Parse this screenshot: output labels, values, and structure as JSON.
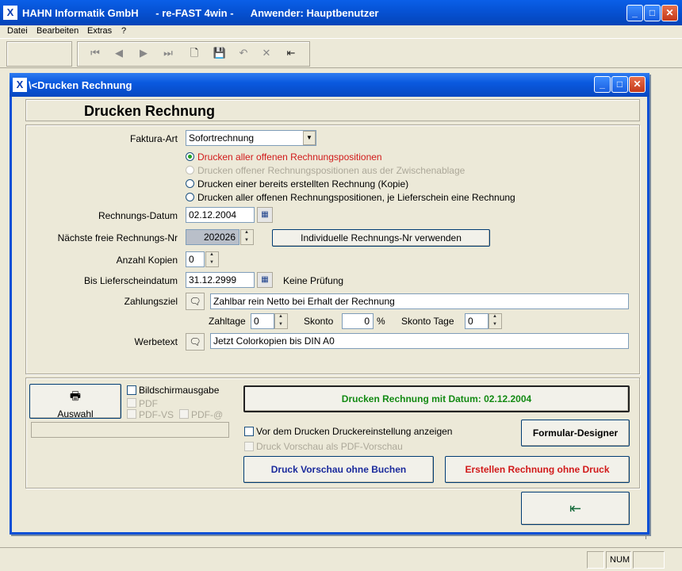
{
  "app": {
    "title": "HAHN Informatik GmbH      - re-FAST 4win -      Anwender: Hauptbenutzer",
    "logo": "X"
  },
  "menu": {
    "datei": "Datei",
    "bearbeiten": "Bearbeiten",
    "extras": "Extras",
    "help": "?"
  },
  "dialog": {
    "title": "\\<Drucken Rechnung",
    "heading": "Drucken Rechnung",
    "faktura_label": "Faktura-Art",
    "faktura_value": "Sofortrechnung",
    "radio1": "Drucken aller offenen Rechnungspositionen",
    "radio2": "Drucken offener Rechnungspositionen aus der Zwischenablage",
    "radio3": "Drucken einer bereits erstellten Rechnung (Kopie)",
    "radio4": "Drucken aller offenen Rechnungspositionen, je Lieferschein eine Rechnung",
    "datum_label": "Rechnungs-Datum",
    "datum_value": "02.12.2004",
    "nr_label": "Nächste freie Rechnungs-Nr",
    "nr_value": "202026",
    "nr_button": "Individuelle Rechnungs-Nr verwenden",
    "kopien_label": "Anzahl Kopien",
    "kopien_value": "0",
    "liefer_label": "Bis Lieferscheindatum",
    "liefer_value": "31.12.2999",
    "liefer_note": "Keine Prüfung",
    "ziel_label": "Zahlungsziel",
    "ziel_value": "Zahlbar rein Netto bei Erhalt der Rechnung",
    "zahltage_label": "Zahltage",
    "zahltage_value": "0",
    "skonto_label": "Skonto",
    "skonto_value": "0",
    "skonto_unit": "%",
    "skontotage_label": "Skonto Tage",
    "skontotage_value": "0",
    "werbe_label": "Werbetext",
    "werbe_value": "Jetzt Colorkopien bis DIN A0",
    "auswahl": "Auswahl",
    "bildschirm": "Bildschirmausgabe",
    "pdf": "PDF",
    "pdfvs": "PDF-VS",
    "pdfat": "PDF-@",
    "print_btn": "Drucken Rechnung mit Datum: 02.12.2004",
    "vor_drucken": "Vor dem Drucken Druckereinstellung anzeigen",
    "vorschau_pdf": "Druck Vorschau als PDF-Vorschau",
    "designer": "Formular-Designer",
    "preview_btn": "Druck Vorschau ohne Buchen",
    "create_btn": "Erstellen Rechnung ohne Druck",
    "exit_icon": "exit-door-icon"
  },
  "status": {
    "num": "NUM"
  },
  "colors": {
    "accent": "#0a5fe8",
    "print_green": "#138a13",
    "preview_blue": "#1a2a9c",
    "create_red": "#d11a1a",
    "radio_red": "#d11a1a"
  }
}
